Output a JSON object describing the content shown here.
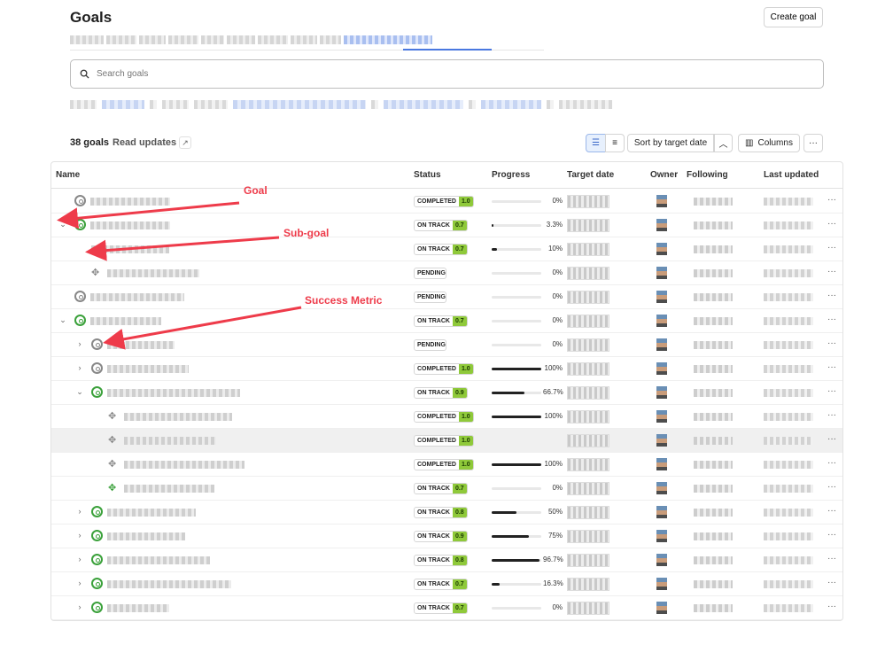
{
  "header": {
    "title": "Goals",
    "create_button": "Create goal"
  },
  "search": {
    "placeholder": "Search goals"
  },
  "toolbar": {
    "count": "38 goals",
    "read_updates": "Read updates",
    "sort_label": "Sort by target date",
    "columns_label": "Columns"
  },
  "table": {
    "columns": [
      "Name",
      "Status",
      "Progress",
      "Target date",
      "Owner",
      "Following",
      "Last updated"
    ],
    "rows": [
      {
        "level": 0,
        "chev": "",
        "icon": "goal",
        "icon_color": "gray",
        "status": "COMPLETED",
        "score": "1.0",
        "progress": 0,
        "pct": "0%",
        "highlight": false
      },
      {
        "level": 0,
        "chev": "down",
        "icon": "goal",
        "icon_color": "green",
        "status": "ON TRACK",
        "score": "0.7",
        "progress": 3.3,
        "pct": "3.3%",
        "highlight": false
      },
      {
        "level": 1,
        "chev": "",
        "icon": "none",
        "icon_color": "gray",
        "status": "ON TRACK",
        "score": "0.7",
        "progress": 10,
        "pct": "10%",
        "highlight": false
      },
      {
        "level": 1,
        "chev": "",
        "icon": "metric",
        "icon_color": "gray",
        "status": "PENDING",
        "score": "",
        "progress": 0,
        "pct": "0%",
        "highlight": false
      },
      {
        "level": 0,
        "chev": "",
        "icon": "goal",
        "icon_color": "gray",
        "status": "PENDING",
        "score": "",
        "progress": 0,
        "pct": "0%",
        "highlight": false
      },
      {
        "level": 0,
        "chev": "down",
        "icon": "goal",
        "icon_color": "green",
        "status": "ON TRACK",
        "score": "0.7",
        "progress": 0,
        "pct": "0%",
        "highlight": false
      },
      {
        "level": 1,
        "chev": "right",
        "icon": "goal",
        "icon_color": "gray",
        "status": "PENDING",
        "score": "",
        "progress": 0,
        "pct": "0%",
        "highlight": false
      },
      {
        "level": 1,
        "chev": "right",
        "icon": "goal",
        "icon_color": "gray",
        "status": "COMPLETED",
        "score": "1.0",
        "progress": 100,
        "pct": "100%",
        "highlight": false
      },
      {
        "level": 1,
        "chev": "down",
        "icon": "goal",
        "icon_color": "green",
        "status": "ON TRACK",
        "score": "0.9",
        "progress": 66.7,
        "pct": "66.7%",
        "highlight": false
      },
      {
        "level": 2,
        "chev": "",
        "icon": "metric",
        "icon_color": "gray",
        "status": "COMPLETED",
        "score": "1.0",
        "progress": 100,
        "pct": "100%",
        "highlight": false
      },
      {
        "level": 2,
        "chev": "",
        "icon": "metric",
        "icon_color": "gray",
        "status": "COMPLETED",
        "score": "1.0",
        "progress": null,
        "pct": "",
        "highlight": true
      },
      {
        "level": 2,
        "chev": "",
        "icon": "metric",
        "icon_color": "gray",
        "status": "COMPLETED",
        "score": "1.0",
        "progress": 100,
        "pct": "100%",
        "highlight": false
      },
      {
        "level": 2,
        "chev": "",
        "icon": "metric",
        "icon_color": "green",
        "status": "ON TRACK",
        "score": "0.7",
        "progress": 0,
        "pct": "0%",
        "highlight": false
      },
      {
        "level": 1,
        "chev": "right",
        "icon": "goal",
        "icon_color": "green",
        "status": "ON TRACK",
        "score": "0.8",
        "progress": 50,
        "pct": "50%",
        "highlight": false
      },
      {
        "level": 1,
        "chev": "right",
        "icon": "goal",
        "icon_color": "green",
        "status": "ON TRACK",
        "score": "0.9",
        "progress": 75,
        "pct": "75%",
        "highlight": false
      },
      {
        "level": 1,
        "chev": "right",
        "icon": "goal",
        "icon_color": "green",
        "status": "ON TRACK",
        "score": "0.8",
        "progress": 96.7,
        "pct": "96.7%",
        "highlight": false
      },
      {
        "level": 1,
        "chev": "right",
        "icon": "goal",
        "icon_color": "green",
        "status": "ON TRACK",
        "score": "0.7",
        "progress": 16.3,
        "pct": "16.3%",
        "highlight": false
      },
      {
        "level": 1,
        "chev": "right",
        "icon": "goal",
        "icon_color": "green",
        "status": "ON TRACK",
        "score": "0.7",
        "progress": 0,
        "pct": "0%",
        "highlight": false
      }
    ]
  },
  "annotations": {
    "goal": "Goal",
    "subgoal": "Sub-goal",
    "metric": "Success Metric"
  },
  "colors": {
    "annotation": "#ee3b4a",
    "status_score_bg": "#8fc93a",
    "goal_green": "#3ba13b",
    "tab_accent": "#4a78e0"
  }
}
